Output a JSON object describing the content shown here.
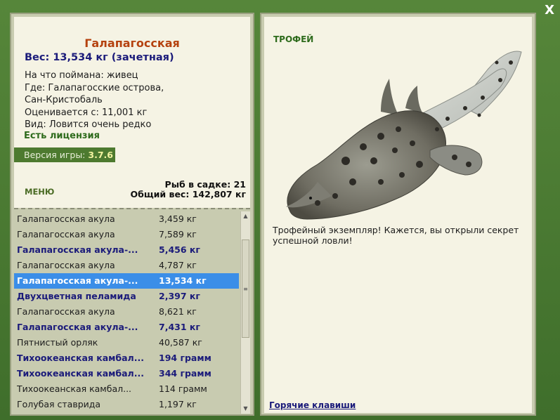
{
  "window": {
    "close_label": "X"
  },
  "fish": {
    "title": "Галапагосская",
    "weight": "Вес: 13,534 кг (зачетная)",
    "caught_with": "На что поймана: живец",
    "where_1": "Где: Галапагосские острова,",
    "where_2": "Сан-Кристобаль",
    "value": "Оценивается с: 11,001 кг",
    "kind": "Вид: Ловится очень редко",
    "license": "Есть лицензия"
  },
  "version": {
    "label": "Версия игры:",
    "value": "3.7.6"
  },
  "menu_label": "МЕНЮ",
  "stats": {
    "fish_in_cage": "Рыб в садке: 21",
    "total_weight": "Общий вес: 142,807 кг"
  },
  "catch_list": [
    {
      "name": "Галапагосская акула",
      "weight": "3,459 кг",
      "style": "normal"
    },
    {
      "name": "Галапагосская акула",
      "weight": "7,589 кг",
      "style": "normal"
    },
    {
      "name": "Галапагосская акула-...",
      "weight": "5,456 кг",
      "style": "bold"
    },
    {
      "name": "Галапагосская акула",
      "weight": "4,787 кг",
      "style": "normal"
    },
    {
      "name": "Галапагосская акула-...",
      "weight": "13,534 кг",
      "style": "selected"
    },
    {
      "name": "Двухцветная пеламида",
      "weight": "2,397 кг",
      "style": "bold"
    },
    {
      "name": "Галапагосская акула",
      "weight": "8,621 кг",
      "style": "normal"
    },
    {
      "name": "Галапагосская акула-...",
      "weight": "7,431 кг",
      "style": "bold"
    },
    {
      "name": "Пятнистый орляк",
      "weight": "40,587 кг",
      "style": "normal"
    },
    {
      "name": "Тихоокеанская камбал...",
      "weight": "194 грамм",
      "style": "bold"
    },
    {
      "name": "Тихоокеанская камбал...",
      "weight": "344 грамм",
      "style": "bold"
    },
    {
      "name": "Тихоокеанская камбал...",
      "weight": "114 грамм",
      "style": "normal"
    },
    {
      "name": "Голубая ставрида",
      "weight": "1,197 кг",
      "style": "normal"
    }
  ],
  "trophy": {
    "label": "ТРОФЕЙ",
    "text": "Трофейный экземпляр! Кажется, вы открыли секрет успешной ловли!",
    "image_icon": "shark-image"
  },
  "hotkeys_label": "Горячие клавиши",
  "colors": {
    "frame": "#4a7a32",
    "panel": "#f5f3e4",
    "title": "#b5420f",
    "bold_text": "#1b1b7a",
    "green_text": "#2e6b1c",
    "selection": "#3b8ee8"
  }
}
